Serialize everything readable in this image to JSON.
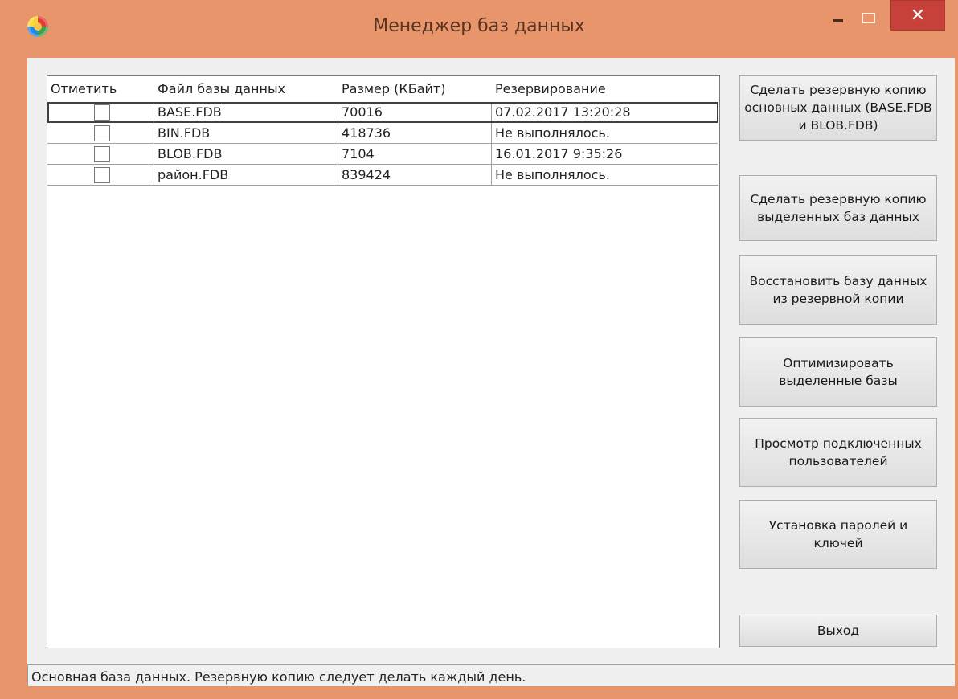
{
  "window": {
    "title": "Менеджер баз данных",
    "icon": "app-logo-icon",
    "controls": {
      "minimize": "–",
      "maximize": "□",
      "close": "✕"
    }
  },
  "table": {
    "columns": [
      "Отметить",
      "Файл базы данных",
      "Размер (КБайт)",
      "Резервирование"
    ],
    "rows": [
      {
        "checked": false,
        "file": "BASE.FDB",
        "size": "70016",
        "backup": "07.02.2017 13:20:28"
      },
      {
        "checked": false,
        "file": "BIN.FDB",
        "size": "418736",
        "backup": "Не выполнялось."
      },
      {
        "checked": false,
        "file": "BLOB.FDB",
        "size": "7104",
        "backup": "16.01.2017 9:35:26"
      },
      {
        "checked": false,
        "file": "район.FDB",
        "size": "839424",
        "backup": "Не выполнялось."
      }
    ]
  },
  "buttons": {
    "backup_main": "Сделать резервную копию основных данных (BASE.FDB и BLOB.FDB)",
    "backup_selected": "Сделать резервную копию выделенных баз данных",
    "restore": "Восстановить базу данных из резервной копии",
    "optimize": "Оптимизировать выделенные базы",
    "view_users": "Просмотр подключенных пользователей",
    "passwords": "Установка паролей и ключей",
    "exit": "Выход"
  },
  "status": "Основная база данных. Резервную копию следует делать каждый день.",
  "colors": {
    "titlebar": "#e8956b",
    "close_button": "#c7403a"
  }
}
